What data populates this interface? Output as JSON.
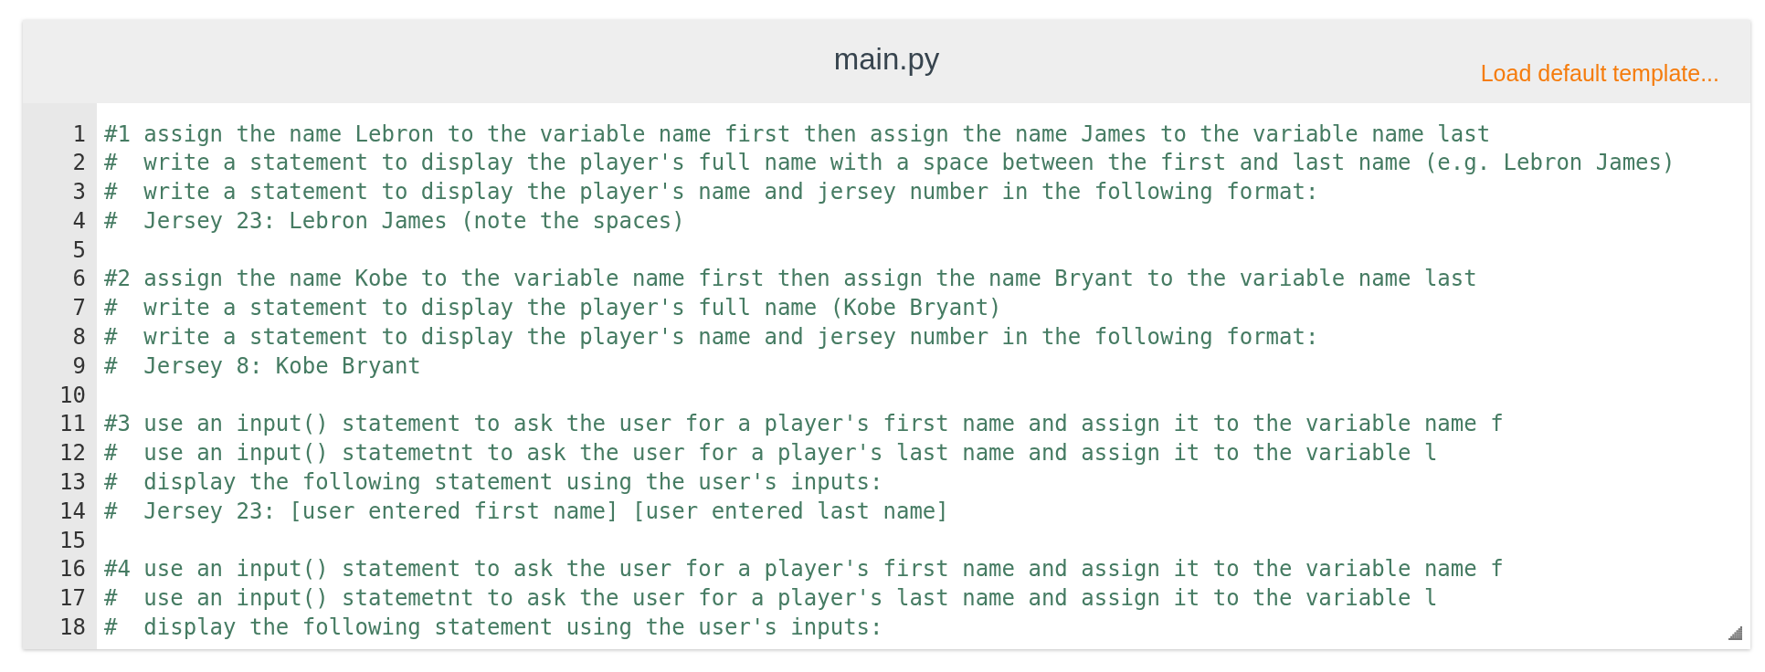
{
  "header": {
    "title": "main.py",
    "action_link": "Load default template..."
  },
  "editor": {
    "lines": [
      {
        "number": "1",
        "text": "#1 assign the name Lebron to the variable name first then assign the name James to the variable name last"
      },
      {
        "number": "2",
        "text": "#  write a statement to display the player's full name with a space between the first and last name (e.g. Lebron James)"
      },
      {
        "number": "3",
        "text": "#  write a statement to display the player's name and jersey number in the following format:"
      },
      {
        "number": "4",
        "text": "#  Jersey 23: Lebron James (note the spaces)"
      },
      {
        "number": "5"
      },
      {
        "number": "6",
        "text": "#2 assign the name Kobe to the variable name first then assign the name Bryant to the variable name last"
      },
      {
        "number": "7",
        "text": "#  write a statement to display the player's full name (Kobe Bryant)"
      },
      {
        "number": "8",
        "text": "#  write a statement to display the player's name and jersey number in the following format:"
      },
      {
        "number": "9",
        "text": "#  Jersey 8: Kobe Bryant"
      },
      {
        "number": "10"
      },
      {
        "number": "11",
        "text": "#3 use an input() statement to ask the user for a player's first name and assign it to the variable name f"
      },
      {
        "number": "12",
        "text": "#  use an input() statemetnt to ask the user for a player's last name and assign it to the variable l"
      },
      {
        "number": "13",
        "text": "#  display the following statement using the user's inputs:"
      },
      {
        "number": "14",
        "text": "#  Jersey 23: [user entered first name] [user entered last name]"
      },
      {
        "number": "15"
      },
      {
        "number": "16",
        "text": "#4 use an input() statement to ask the user for a player's first name and assign it to the variable name f"
      },
      {
        "number": "17",
        "text": "#  use an input() statemetnt to ask the user for a player's last name and assign it to the variable l"
      },
      {
        "number": "18",
        "text": "#  display the following statement using the user's inputs:"
      }
    ]
  }
}
